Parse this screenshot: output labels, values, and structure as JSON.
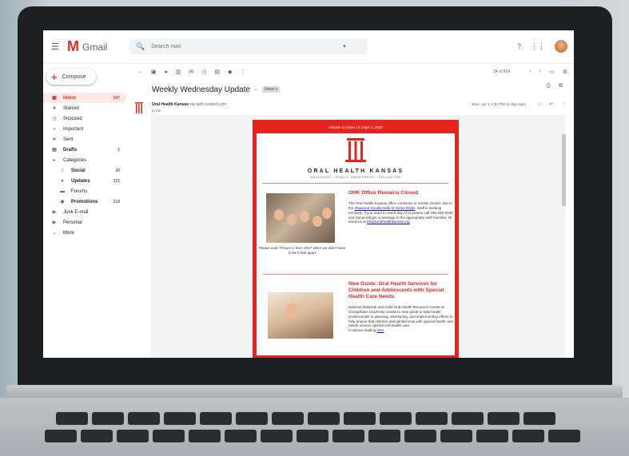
{
  "app": {
    "name": "Gmail",
    "accent": "#d93025"
  },
  "search": {
    "placeholder": "Search mail"
  },
  "compose": {
    "label": "Compose"
  },
  "sidebar": {
    "items": [
      {
        "label": "Inbox",
        "count": "247",
        "icon": "inbox-icon"
      },
      {
        "label": "Starred",
        "count": "",
        "icon": "star-icon"
      },
      {
        "label": "Snoozed",
        "count": "",
        "icon": "clock-icon"
      },
      {
        "label": "Important",
        "count": "",
        "icon": "important-icon"
      },
      {
        "label": "Sent",
        "count": "",
        "icon": "send-icon"
      },
      {
        "label": "Drafts",
        "count": "1",
        "icon": "draft-icon"
      },
      {
        "label": "Categories",
        "count": "",
        "icon": "label-icon"
      },
      {
        "label": "Social",
        "count": "20",
        "icon": "people-icon"
      },
      {
        "label": "Updates",
        "count": "272",
        "icon": "info-icon"
      },
      {
        "label": "Forums",
        "count": "",
        "icon": "forum-icon"
      },
      {
        "label": "Promotions",
        "count": "218",
        "icon": "tag-icon"
      },
      {
        "label": "Junk E-mail",
        "count": "",
        "icon": "label-icon"
      },
      {
        "label": "Personal",
        "count": "",
        "icon": "label-icon"
      },
      {
        "label": "More",
        "count": "",
        "icon": "chevron-down-icon"
      }
    ]
  },
  "toolbar": {
    "pager": "34 of 824"
  },
  "message": {
    "subject": "Weekly Wednesday Update",
    "label": "Inbox x",
    "sender_name": "Oral Health Kansas",
    "sender_via": "via auth.ccsend.com",
    "to": "to me",
    "date": "Wed, Apr 1, 4:51 PM (6 days ago)"
  },
  "newsletter": {
    "volume": "Volume 11 Issue 13 | April 1, 2020",
    "org_name": "ORAL HEALTH KANSAS",
    "tagline": "ADVOCACY • PUBLIC AWARENESS • EDUCATION",
    "article1": {
      "title": "OHK Office Remains Closed",
      "text_a": "The Oral Health Kansas office continues to remain closed, due to the ",
      "link1": "Shawnee County Safe At Home Order",
      "text_b": ". Staff is working remotely. If you need to reach any of us please call 785-235-6039 and Sonia will get a message to the appropriate staff member. Or email us at ",
      "email": "info@oralhealthkansas.org",
      "caption": "Please note: Picture is from 2017 when we didn't have to be 6 feet apart"
    },
    "article2": {
      "title": "New Guide: Oral Health Services for Children and Adolescents with Special Health Care Needs",
      "text": "National Maternal and Child Oral Health Resource Center at Georgetown University created a new guide to help health professionals in planning, developing, and implementing efforts to help ensure that children and adolescents with special health care needs receive optimal oral health care.",
      "continue": "Continue reading ",
      "link": "here"
    }
  }
}
